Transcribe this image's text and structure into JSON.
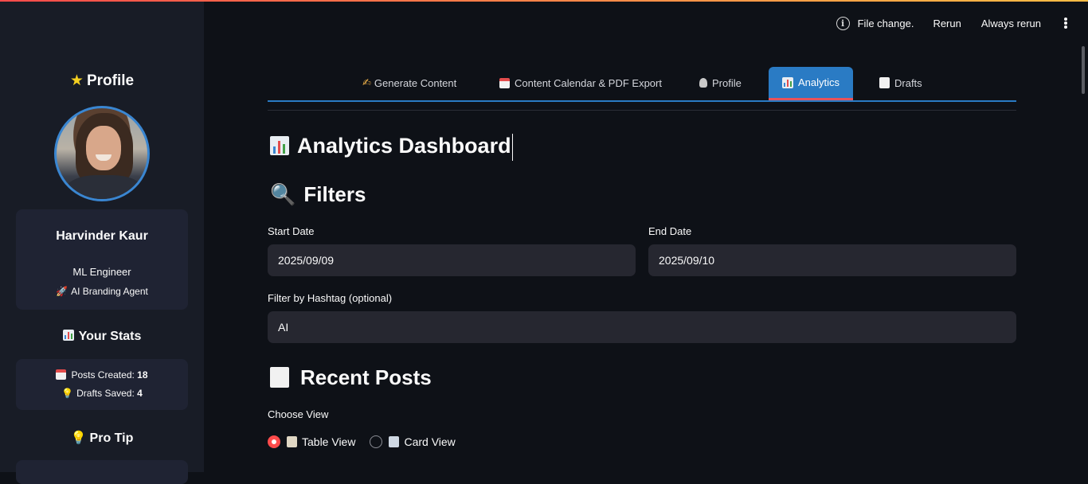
{
  "toolbar": {
    "status": "File change.",
    "rerun": "Rerun",
    "always_rerun": "Always rerun"
  },
  "sidebar": {
    "profile_heading": "Profile",
    "name": "Harvinder Kaur",
    "role": "ML Engineer",
    "tagline": "AI Branding Agent",
    "stats_heading": "Your Stats",
    "posts_label": "Posts Created:",
    "posts_value": "18",
    "drafts_label": "Drafts Saved:",
    "drafts_value": "4",
    "pro_tip_heading": "Pro Tip",
    "icons": {
      "profile": "star-icon",
      "tagline": "rocket-icon",
      "stats": "bar-chart-icon",
      "posts": "calendar-icon",
      "drafts": "lightbulb-icon",
      "pro_tip": "lightbulb-icon"
    }
  },
  "tabs": [
    {
      "label": "Generate Content",
      "icon": "writing-hand-icon",
      "active": false
    },
    {
      "label": "Content Calendar & PDF Export",
      "icon": "calendar-icon",
      "active": false
    },
    {
      "label": "Profile",
      "icon": "person-icon",
      "active": false
    },
    {
      "label": "Analytics",
      "icon": "bar-chart-icon",
      "active": true
    },
    {
      "label": "Drafts",
      "icon": "memo-icon",
      "active": false
    }
  ],
  "main": {
    "title": "Analytics Dashboard",
    "filters_heading": "Filters",
    "start_date_label": "Start Date",
    "start_date_value": "2025/09/09",
    "end_date_label": "End Date",
    "end_date_value": "2025/09/10",
    "hashtag_label": "Filter by Hashtag (optional)",
    "hashtag_value": "AI",
    "recent_posts_heading": "Recent Posts",
    "view_label": "Choose View",
    "view_options": [
      {
        "label": "Table View",
        "icon": "clipboard-icon",
        "selected": true
      },
      {
        "label": "Card View",
        "icon": "card-index-icon",
        "selected": false
      }
    ]
  },
  "colors": {
    "accent": "#ff4b4b",
    "tab_active": "#2a7bc4",
    "background": "#0e1117",
    "sidebar": "#181c26",
    "input": "#262730"
  }
}
